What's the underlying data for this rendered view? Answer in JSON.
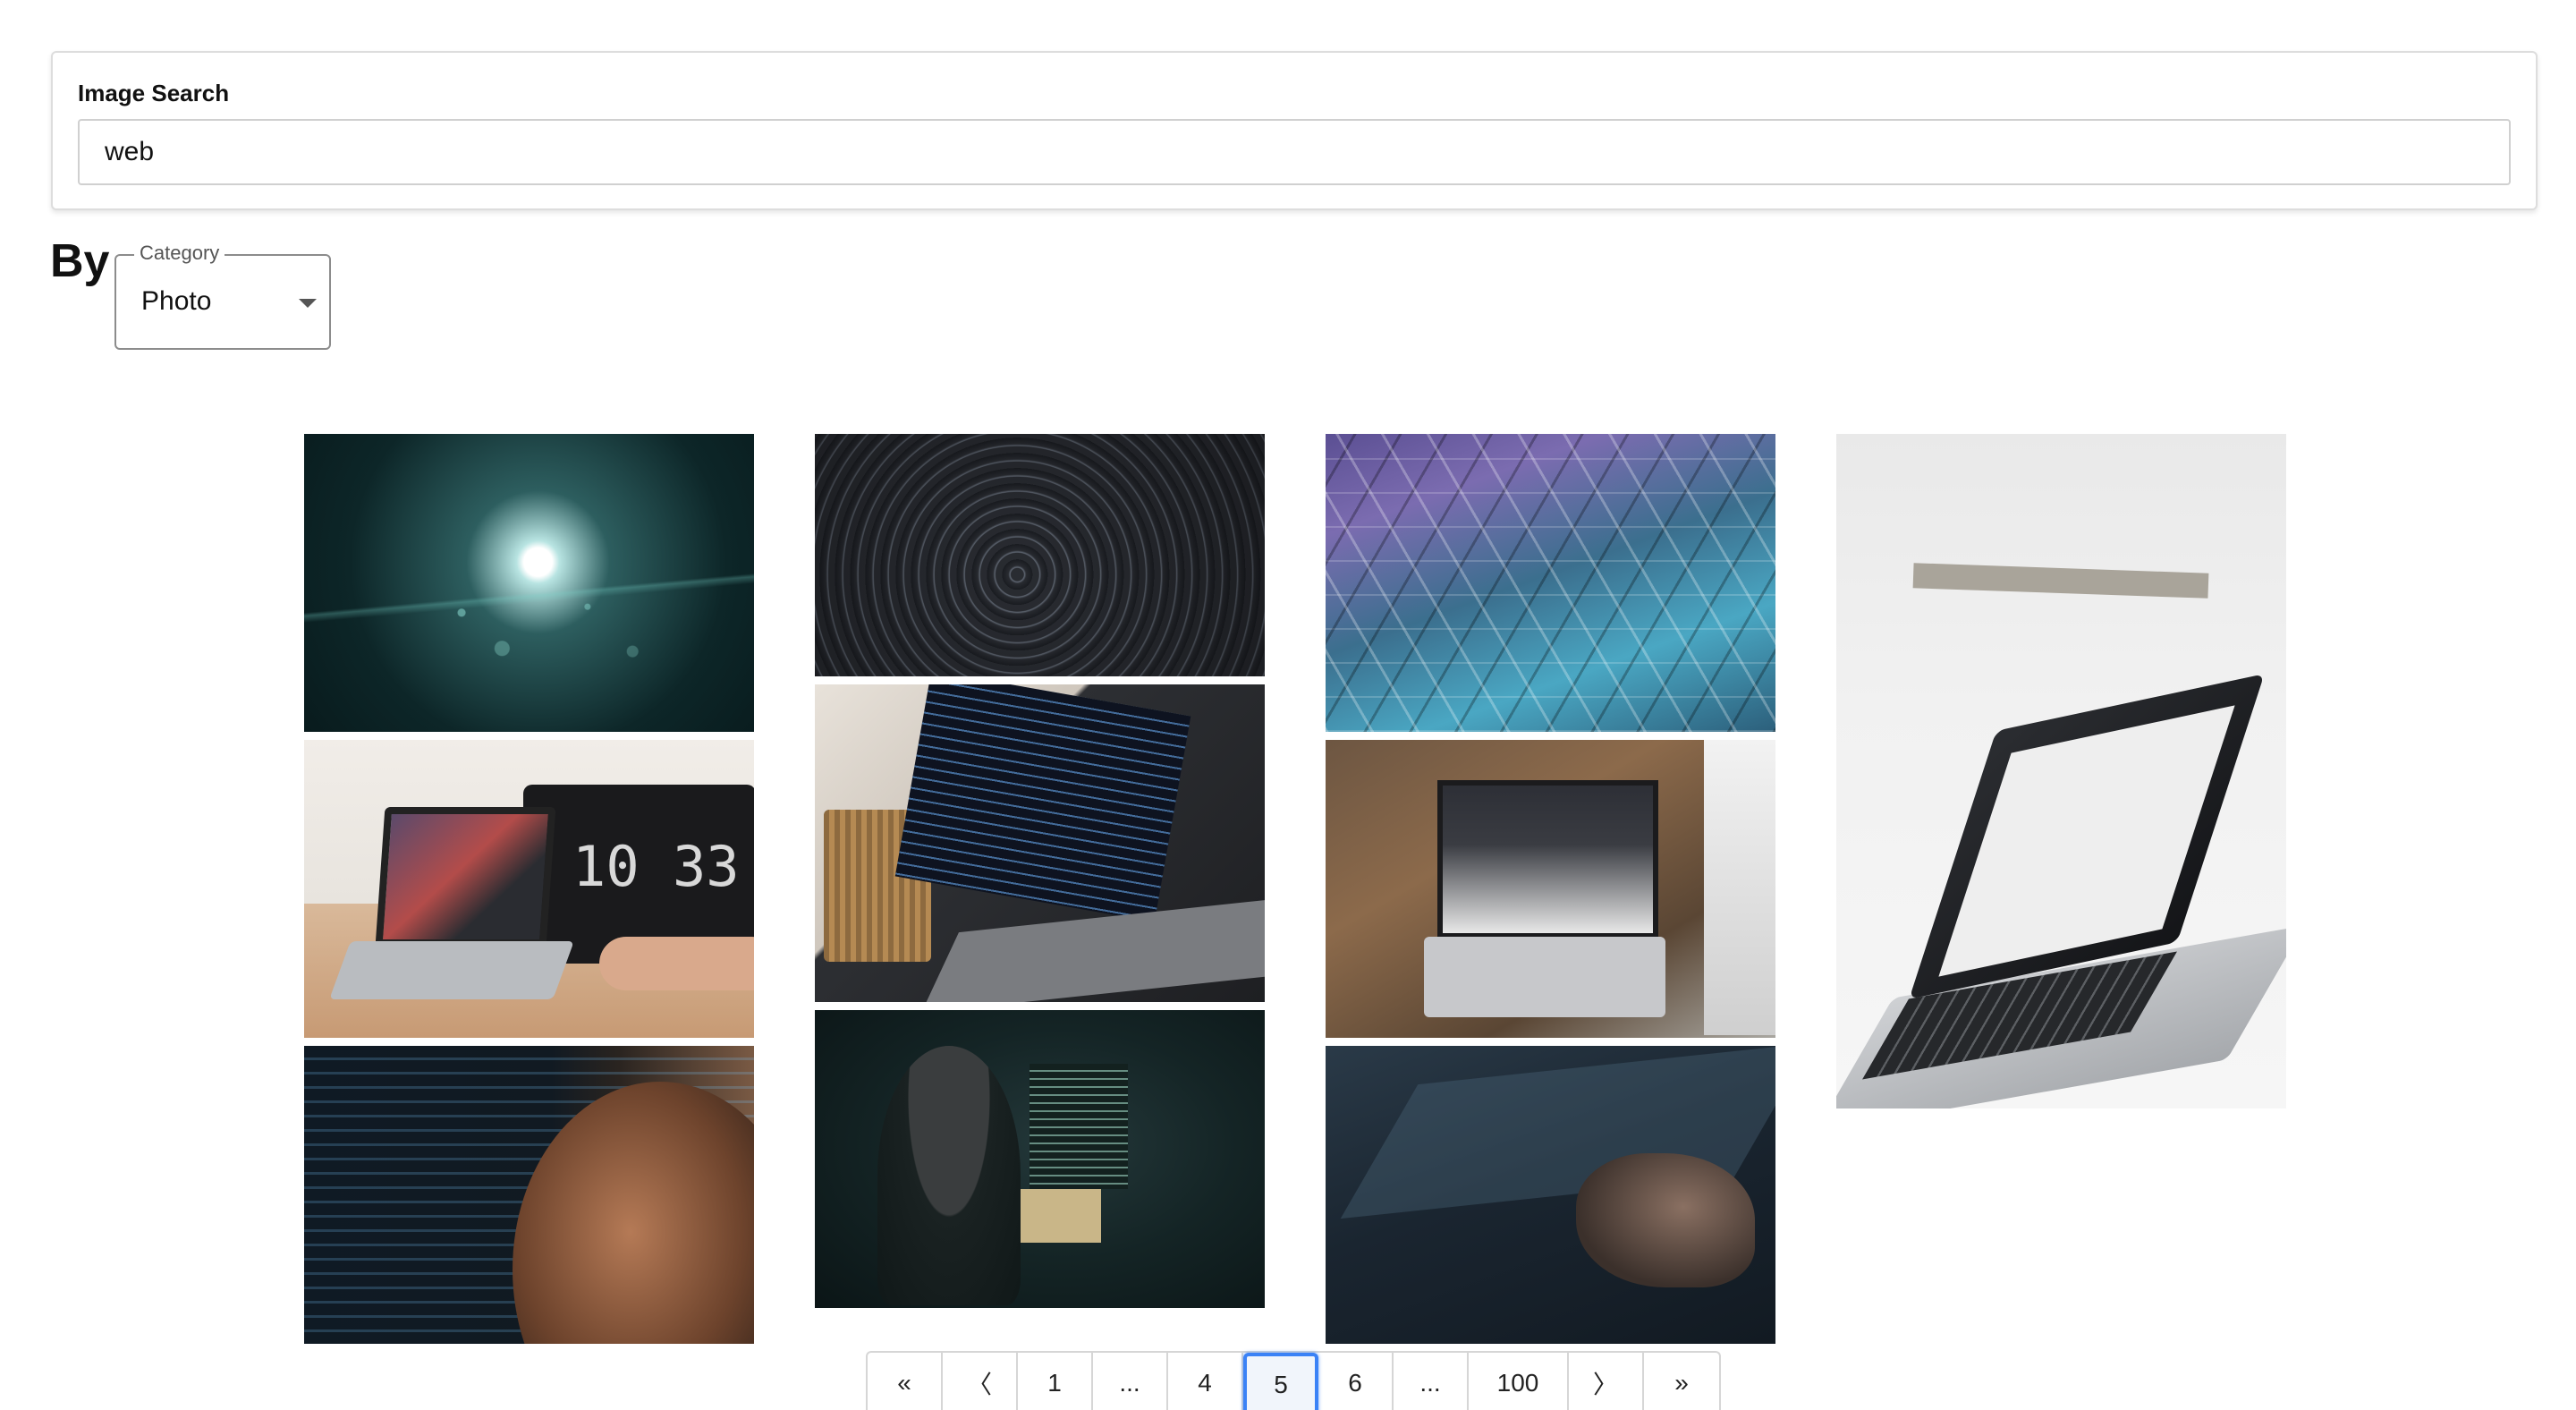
{
  "search": {
    "label": "Image Search",
    "value": "web"
  },
  "filter": {
    "by_label": "By",
    "category_legend": "Category",
    "category_value": "Photo"
  },
  "gallery": {
    "tiles": [
      "lens-flare-bokeh",
      "star-trails",
      "geometric-ceiling",
      "laptop-on-white-table",
      "desk-setup-laptop-clock",
      "laptop-code-pencil-cup",
      "laptop-on-wooden-desk",
      "code-on-screen-person",
      "person-working-dark-room",
      "hand-with-stylus-tablet"
    ]
  },
  "pagination": {
    "first": "«",
    "prev": "〈",
    "pages": [
      "1",
      "...",
      "4",
      "5",
      "6",
      "...",
      "100"
    ],
    "next": "〉",
    "last": "»",
    "current": "5"
  },
  "colors": {
    "accent": "#3b82f6",
    "border": "#d6d6d6"
  }
}
